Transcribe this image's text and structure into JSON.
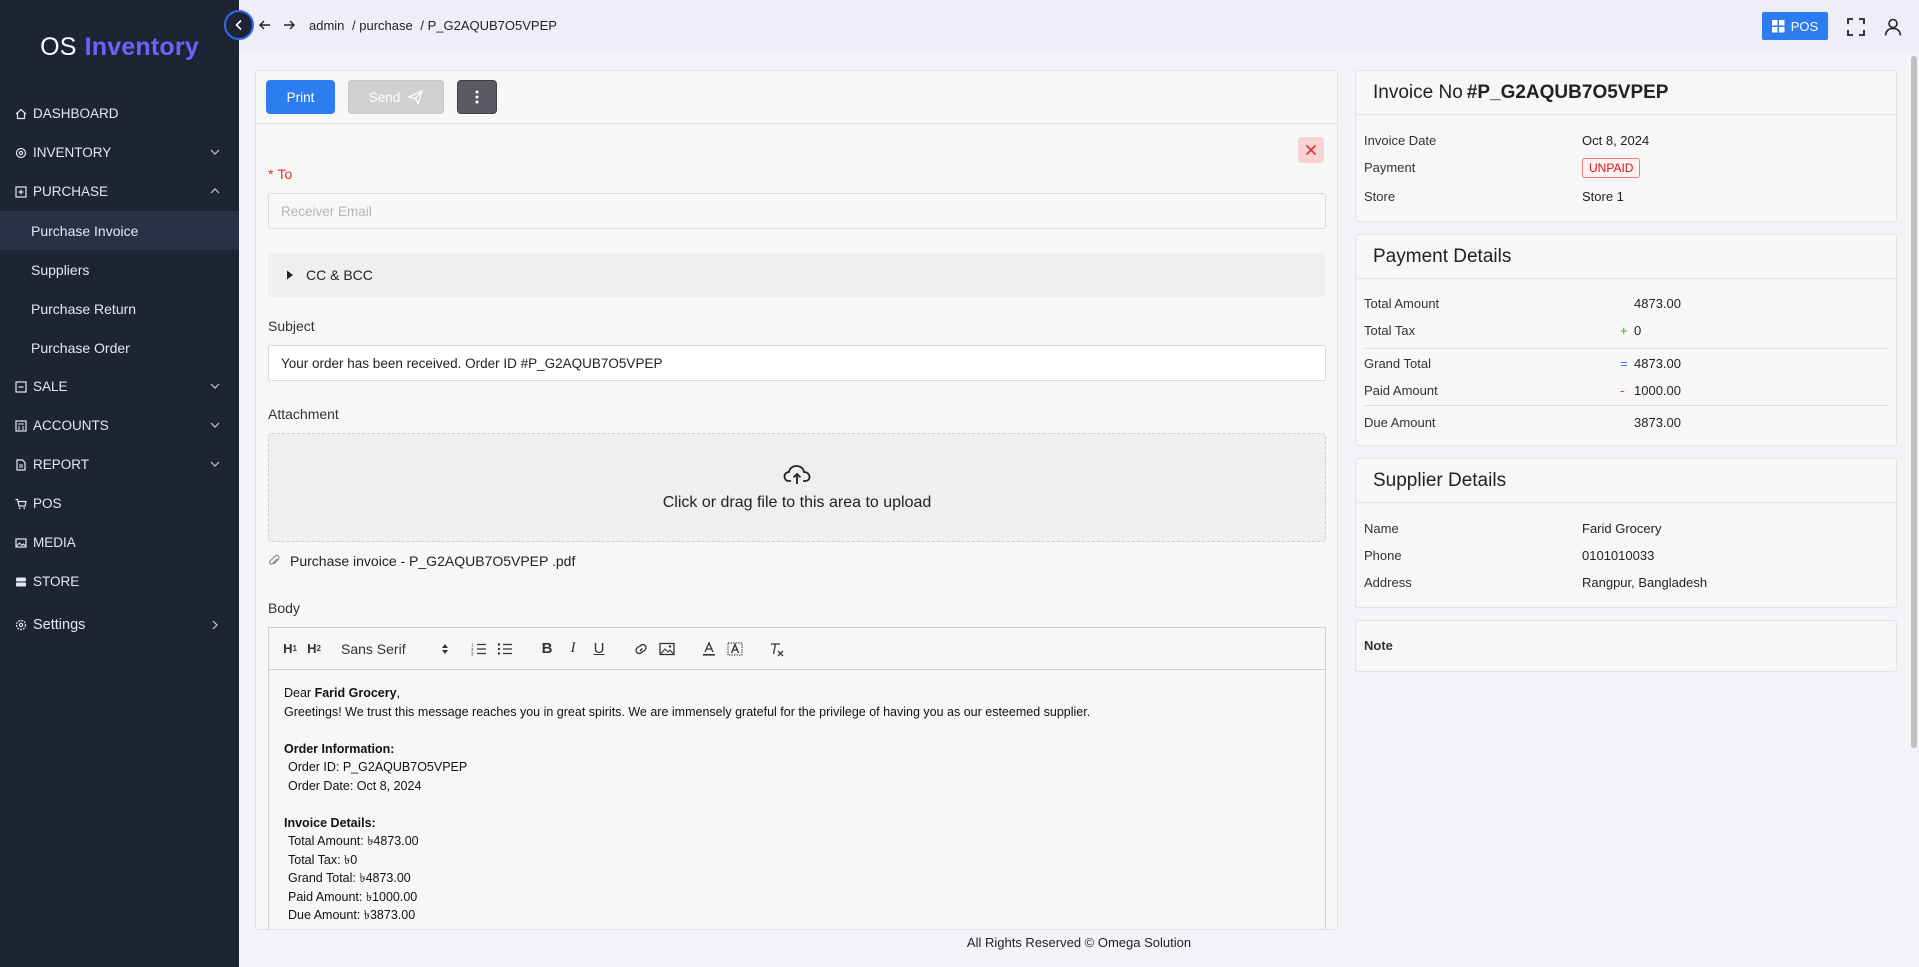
{
  "app": {
    "logo_prefix": "OS",
    "logo_brand": "Inventory",
    "brand_color": "#6c63ff",
    "accent": "#2d7cf0"
  },
  "sidebar": {
    "dashboard": "DASHBOARD",
    "inventory": "INVENTORY",
    "purchase": "PURCHASE",
    "purchase_sub": [
      "Purchase Invoice",
      "Suppliers",
      "Purchase Return",
      "Purchase Order"
    ],
    "sale": "SALE",
    "accounts": "ACCOUNTS",
    "report": "REPORT",
    "pos": "POS",
    "media": "MEDIA",
    "store": "STORE",
    "settings": "Settings"
  },
  "topbar": {
    "breadcrumb": [
      "admin",
      "/ purchase",
      "/ P_G2AQUB7O5VPEP"
    ],
    "pos_label": "POS"
  },
  "toolbar": {
    "print": "Print",
    "send": "Send"
  },
  "form": {
    "to_label": "To",
    "to_placeholder": "Receiver Email",
    "cc_label": "CC & BCC",
    "subject_label": "Subject",
    "subject_value": "Your order has been received. Order ID #P_G2AQUB7O5VPEP",
    "attachment_label": "Attachment",
    "upload_text": "Click or drag file to this area to upload",
    "file_name": "Purchase invoice - P_G2AQUB7O5VPEP .pdf",
    "body_label": "Body",
    "font_select": "Sans Serif"
  },
  "email_body": {
    "dear": "Dear",
    "supplier": "Farid Grocery",
    "comma": ",",
    "greeting": "Greetings! We trust this message reaches you in great spirits. We are immensely grateful for the privilege of having you as our esteemed supplier.",
    "order_info_title": "Order Information:",
    "order_id": "Order ID: P_G2AQUB7O5VPEP",
    "order_date": "Order Date: Oct 8, 2024",
    "invoice_details_title": "Invoice Details:",
    "total_amount": "Total Amount: ৳4873.00",
    "total_tax": "Total Tax: ৳0",
    "grand_total": "Grand Total: ৳4873.00",
    "paid_amount": "Paid Amount: ৳1000.00",
    "due_amount": "Due Amount: ৳3873.00"
  },
  "invoice": {
    "title": "Invoice No",
    "number": "#P_G2AQUB7O5VPEP",
    "date_label": "Invoice Date",
    "date_value": "Oct 8, 2024",
    "payment_label": "Payment",
    "payment_status": "UNPAID",
    "store_label": "Store",
    "store_value": "Store 1"
  },
  "payment": {
    "title": "Payment Details",
    "total_amount_label": "Total Amount",
    "total_amount": "4873.00",
    "total_tax_label": "Total Tax",
    "total_tax": "0",
    "grand_total_label": "Grand Total",
    "grand_total": "4873.00",
    "paid_amount_label": "Paid Amount",
    "paid_amount": "1000.00",
    "due_amount_label": "Due Amount",
    "due_amount": "3873.00",
    "op_plus": "+",
    "op_equals": "=",
    "op_minus": "-"
  },
  "supplier": {
    "title": "Supplier Details",
    "name_label": "Name",
    "name": "Farid Grocery",
    "phone_label": "Phone",
    "phone": "0101010033",
    "address_label": "Address",
    "address": "Rangpur, Bangladesh"
  },
  "note": {
    "title": "Note"
  },
  "footer": {
    "text": "All Rights Reserved © Omega Solution"
  }
}
